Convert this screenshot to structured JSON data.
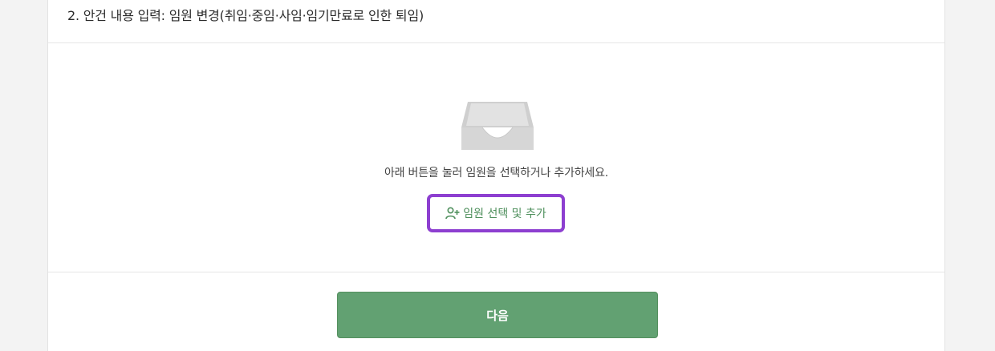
{
  "section": {
    "title": "2. 안건 내용 입력: 임원 변경(취임·중임·사임·임기만료로 인한 퇴임)"
  },
  "empty_state": {
    "icon": "inbox-tray-icon",
    "message": "아래 버튼을 눌러 임원을 선택하거나 추가하세요."
  },
  "add_button": {
    "icon": "user-plus-icon",
    "label": "임원 선택 및 추가"
  },
  "next_button": {
    "label": "다음"
  },
  "colors": {
    "accent_green": "#62a172",
    "highlight_purple": "#8d3fd0",
    "text_green": "#4e8f5c"
  }
}
